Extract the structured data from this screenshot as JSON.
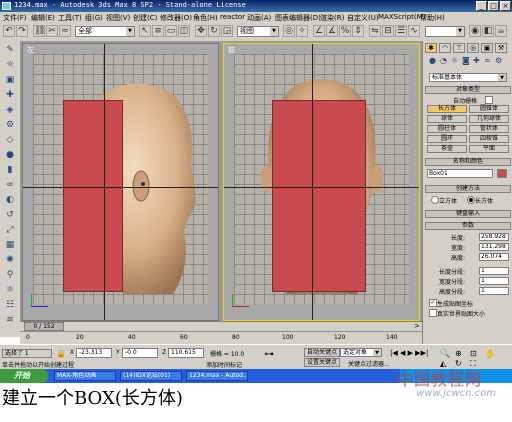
{
  "window": {
    "title": "1234.max - Autodesk 3ds Max 8 SP2 - Stand-alone License",
    "btn_min": "_",
    "btn_max": "□",
    "btn_close": "×"
  },
  "menu": [
    "文件(F)",
    "编辑(E)",
    "工具(T)",
    "组(G)",
    "视图(V)",
    "创建(C)",
    "修改器(O)",
    "角色(H)",
    "reactor",
    "动画(A)",
    "图表编辑器(D)",
    "渲染(R)",
    "自定义(U)",
    "MAXScript(M)",
    "帮助(H)"
  ],
  "toolbar": {
    "selection_filter": "全部",
    "coord_system": "视图"
  },
  "viewports": [
    {
      "label": "左",
      "box": "box01"
    },
    {
      "label": "前",
      "box": "box01"
    }
  ],
  "timeline": {
    "frame": "0 / 152"
  },
  "ruler_ticks": [
    "0",
    "20",
    "40",
    "60",
    "80",
    "100",
    "120",
    "140"
  ],
  "status": {
    "selected": "选择了 1",
    "hint": "单击并拖动以开始创建过程",
    "x_label": "X",
    "x": "-23.313",
    "y_label": "Y",
    "y": "-0.0",
    "z_label": "Z",
    "z": "110.615",
    "grid": "栅格 = 10.0",
    "add_tag": "添加时间标记",
    "auto_key": "自动关键点",
    "set_key": "设置关键点",
    "selected_objects": "选定对象",
    "key_filter": "关键点过滤器..."
  },
  "panel": {
    "category": "标准基本体",
    "object_type_header": "对象类型",
    "autogrid": "自动栅格",
    "objects": [
      "长方体",
      "圆锥体",
      "球体",
      "几何球体",
      "圆柱体",
      "管状体",
      "圆环",
      "四棱锥",
      "茶壶",
      "平面"
    ],
    "name_color_header": "名称和颜色",
    "object_name": "Box01",
    "creation_method_header": "创建方法",
    "method_cube": "立方体",
    "method_box": "长方体",
    "keyboard_input": "键盘输入",
    "params_header": "参数",
    "params": [
      {
        "label": "长度:",
        "value": "258.928"
      },
      {
        "label": "宽度:",
        "value": "131.298"
      },
      {
        "label": "高度:",
        "value": "26.074"
      },
      {
        "label": "长度分段:",
        "value": "1"
      },
      {
        "label": "宽度分段:",
        "value": "1"
      },
      {
        "label": "高度分段:",
        "value": "1"
      }
    ],
    "gen_uv": "生成贴图坐标",
    "real_world": "真实世界贴图大小"
  },
  "taskbar": {
    "start": "开始",
    "tasks": [
      "MAX-角色动画",
      "(14)IDX论坛(01)",
      "1234.max - Autod..."
    ]
  },
  "caption": "建立一个BOX(长方体)",
  "watermark": {
    "line1": "中国教程网",
    "line2": "www.jcwcn.com"
  },
  "colors": {
    "box": "#c94a4f",
    "titlebar": "#0a246a",
    "panel": "#d4d0c8",
    "selected_button": "#f5c96b"
  }
}
